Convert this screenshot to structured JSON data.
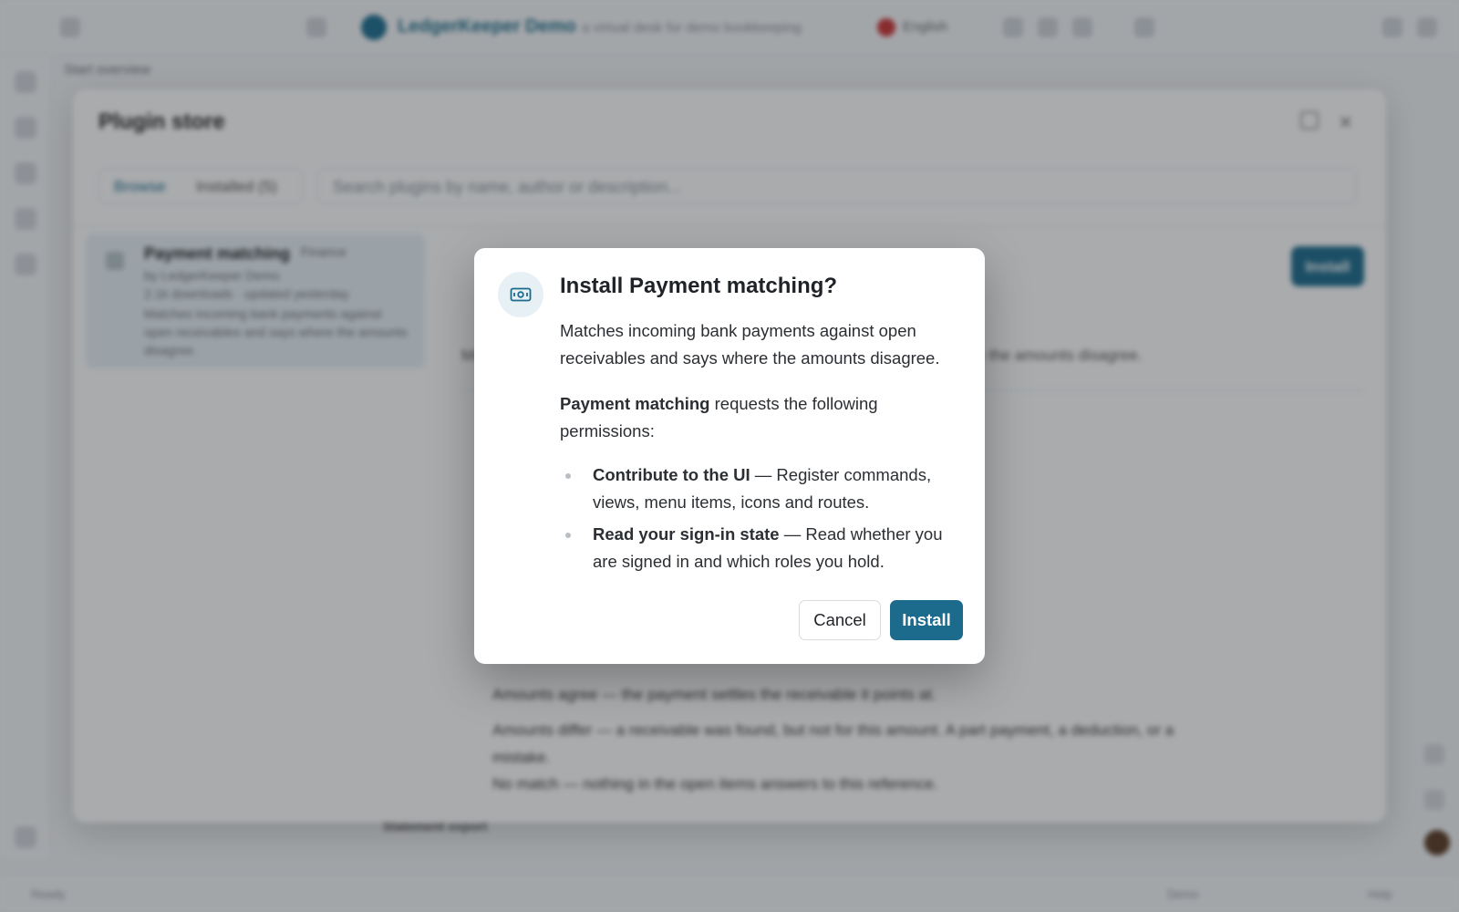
{
  "app": {
    "brand": "LedgerKeeper Demo",
    "brand_sub": "a virtual desk for demo bookkeeping",
    "language": "English",
    "breadcrumb": "Start overview"
  },
  "store": {
    "title": "Plugin store",
    "tabs": [
      {
        "label": "Browse"
      },
      {
        "label": "Installed (5)"
      }
    ],
    "search_placeholder": "Search plugins by name, author or description...",
    "install_label": "Install",
    "card": {
      "name": "Payment matching",
      "badge": "Finance",
      "author": "by LedgerKeeper Demo",
      "meta": "2.1k downloads · updated yesterday",
      "summary": "Matches incoming bank payments against open receivables and says where the amounts disagree."
    },
    "detail_lines": [
      "Matches incoming bank payments against open receivables and says where the amounts disagree.",
      "Amounts agree — the payment settles the receivable it points at.",
      "Amounts differ — a receivable was found, but not for this amount. A part payment, a deduction, or a mistake.",
      "No match — nothing in the open items answers to this reference."
    ],
    "footer_label": "Statement export"
  },
  "dialog": {
    "title": "Install Payment matching?",
    "description": "Matches incoming bank payments against open receivables and says where the amounts disagree.",
    "plugin_name": "Payment matching",
    "request_text": "requests the following permissions:",
    "permissions": [
      {
        "name": "Contribute to the UI",
        "detail": "— Register commands, views, menu items, icons and routes."
      },
      {
        "name": "Read your sign-in state",
        "detail": "— Read whether you are signed in and which roles you hold."
      }
    ],
    "cancel_label": "Cancel",
    "install_label": "Install",
    "icon": "money-bill-icon",
    "accent_color": "#1c6b8d"
  },
  "statusbar": {
    "left": "Ready",
    "middle": "Demo",
    "right": "Help"
  }
}
